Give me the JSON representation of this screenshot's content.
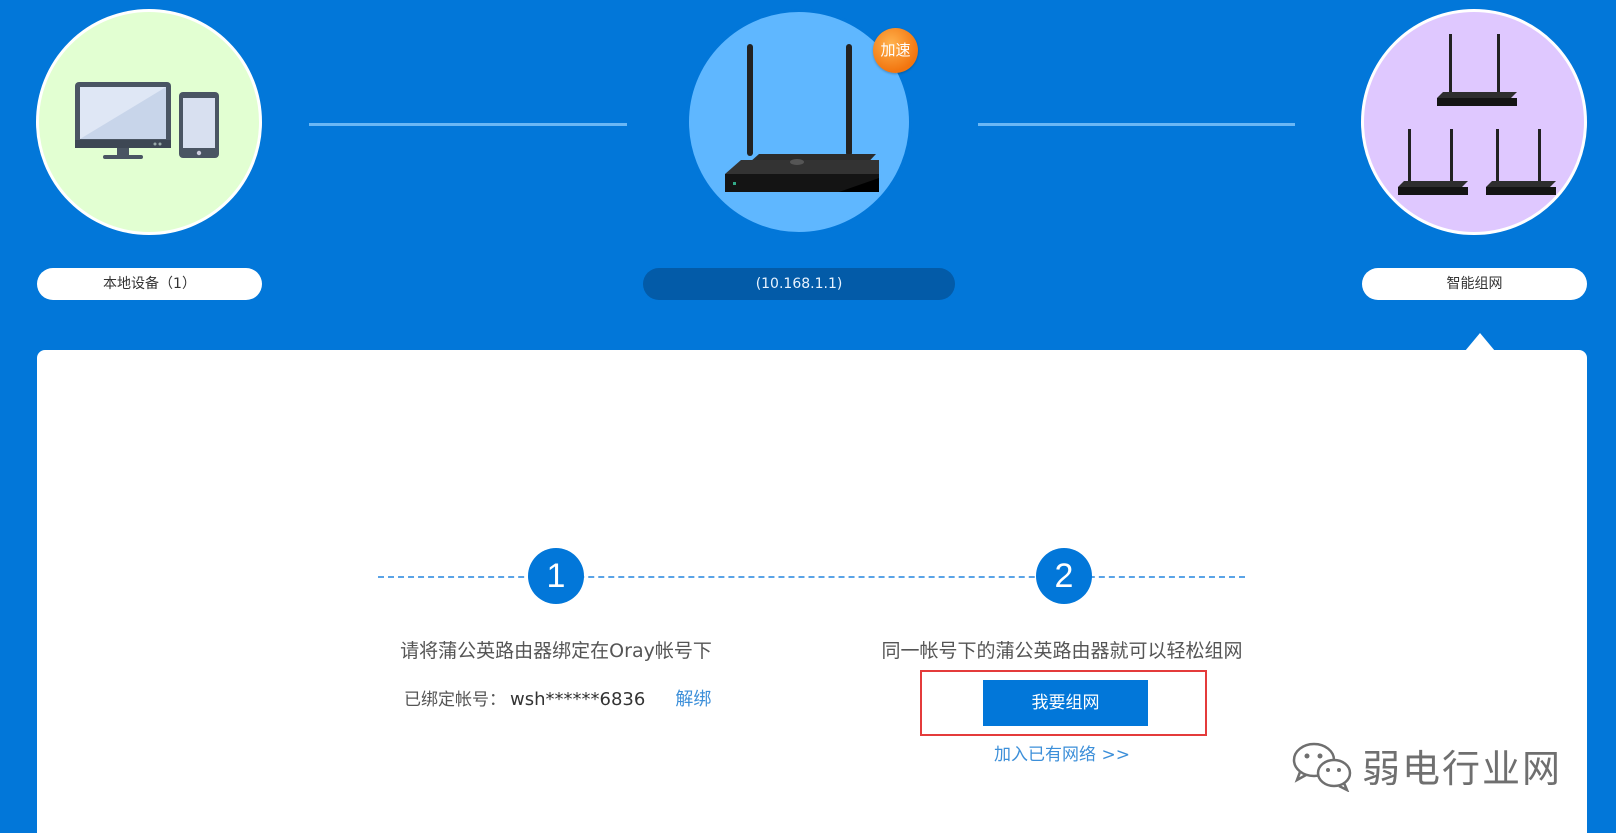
{
  "topology": {
    "local": {
      "label": "本地设备（1）"
    },
    "router": {
      "badge": "加速",
      "label": "(10.168.1.1)"
    },
    "mesh": {
      "label": "智能组网"
    }
  },
  "steps": [
    {
      "number": "1",
      "text": "请将蒲公英路由器绑定在Oray帐号下"
    },
    {
      "number": "2",
      "text": "同一帐号下的蒲公英路由器就可以轻松组网"
    }
  ],
  "binding": {
    "label": "已绑定帐号：",
    "account": "wsh******6836",
    "unbind": "解绑"
  },
  "actions": {
    "create_network": "我要组网",
    "join_network": "加入已有网络 >>"
  },
  "watermark": {
    "text": "弱电行业网",
    "icon": "wechat-icon"
  },
  "colors": {
    "brand_blue": "#0277d9",
    "local_bg": "#e2ffd2",
    "router_bg": "#5fb7ff",
    "mesh_bg": "#dfc8ff",
    "badge_orange": "#f2750f",
    "highlight_red": "#e43b3b"
  }
}
